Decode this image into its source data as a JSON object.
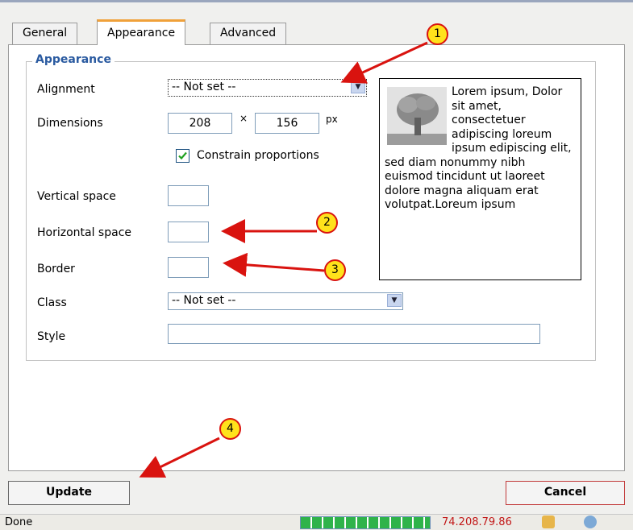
{
  "tabs": [
    {
      "label": "General"
    },
    {
      "label": "Appearance"
    },
    {
      "label": "Advanced"
    }
  ],
  "fieldset": {
    "legend": "Appearance"
  },
  "alignment": {
    "label": "Alignment",
    "value": "-- Not set --"
  },
  "dimensions": {
    "label": "Dimensions",
    "width": "208",
    "times": "×",
    "height": "156",
    "unit": "px"
  },
  "constrain": {
    "label": "Constrain proportions",
    "checked": true
  },
  "vertical_space": {
    "label": "Vertical space",
    "value": ""
  },
  "horizontal_space": {
    "label": "Horizontal space",
    "value": ""
  },
  "border": {
    "label": "Border",
    "value": ""
  },
  "class_field": {
    "label": "Class",
    "value": "-- Not set --"
  },
  "style_field": {
    "label": "Style",
    "value": ""
  },
  "preview": {
    "text": "Lorem ipsum, Dolor sit amet, consectetuer adipiscing loreum ipsum edipiscing elit, sed diam nonummy nibh euismod tincidunt ut laoreet dolore magna aliquam erat volutpat.Loreum ipsum"
  },
  "buttons": {
    "update": "Update",
    "cancel": "Cancel"
  },
  "status": {
    "left": "Done",
    "ip": "74.208.79.86"
  },
  "callouts": [
    "1",
    "2",
    "3",
    "4"
  ],
  "colors": {
    "accent_tab": "#f0a13a",
    "legend": "#2a5aa0",
    "callout_fill": "#ffe21b",
    "arrow": "#d9130f"
  }
}
